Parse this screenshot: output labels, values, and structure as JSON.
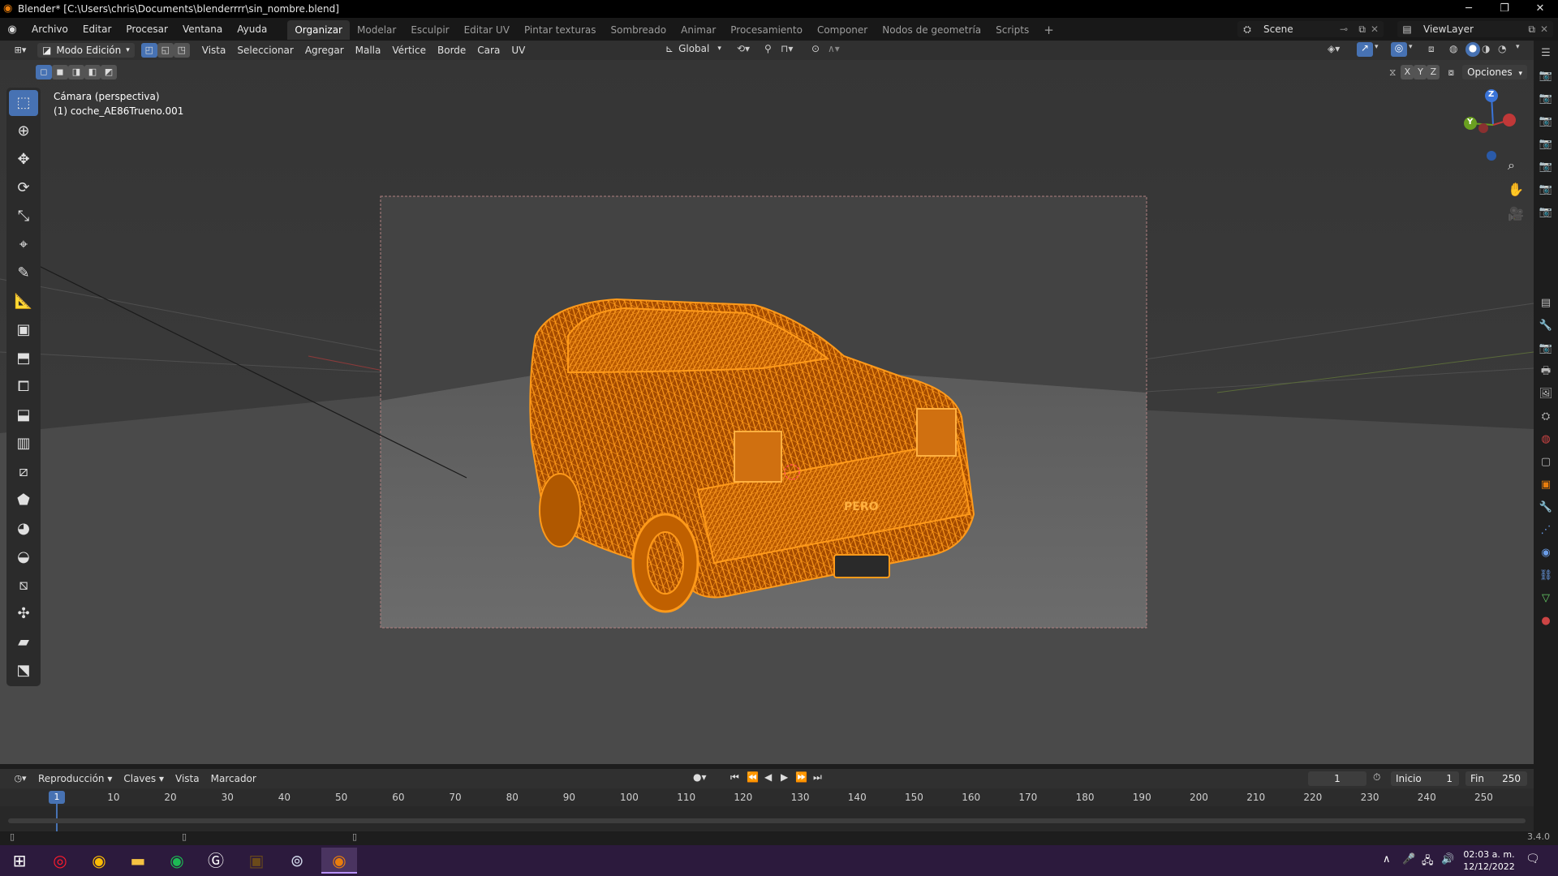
{
  "window": {
    "title": "Blender* [C:\\Users\\chris\\Documents\\blenderrrr\\sin_nombre.blend]",
    "minimize": "─",
    "maximize": "❐",
    "close": "✕"
  },
  "menu": {
    "items": [
      "Archivo",
      "Editar",
      "Procesar",
      "Ventana",
      "Ayuda"
    ],
    "workspaces": [
      "Organizar",
      "Modelar",
      "Esculpir",
      "Editar UV",
      "Pintar texturas",
      "Sombreado",
      "Animar",
      "Procesamiento",
      "Componer",
      "Nodos de geometría",
      "Scripts"
    ],
    "active_workspace": "Organizar",
    "add_tab": "+",
    "scene": "Scene",
    "view_layer": "ViewLayer"
  },
  "header3d": {
    "mode": "Modo Edición",
    "menus": [
      "Vista",
      "Seleccionar",
      "Agregar",
      "Malla",
      "Vértice",
      "Borde",
      "Cara",
      "UV"
    ],
    "orientation": "Global",
    "axes": [
      "X",
      "Y",
      "Z"
    ],
    "options": "Opciones"
  },
  "viewport": {
    "camera_label": "Cámara (perspectiva)",
    "object_label": "(1) coche_AE86Trueno.001",
    "plate_text": "PERO",
    "gizmo": {
      "z": "Z",
      "y": "Y"
    }
  },
  "timeline": {
    "menus": [
      "Reproducción",
      "Claves",
      "Vista",
      "Marcador"
    ],
    "current_frame": "1",
    "start_label": "Inicio",
    "start": "1",
    "end_label": "Fin",
    "end": "250",
    "ticks": [
      "10",
      "20",
      "30",
      "40",
      "50",
      "60",
      "70",
      "80",
      "90",
      "100",
      "110",
      "120",
      "130",
      "140",
      "150",
      "160",
      "170",
      "180",
      "190",
      "200",
      "210",
      "220",
      "230",
      "240",
      "250"
    ],
    "frame_marker": "1"
  },
  "status": {
    "version": "3.4.0"
  },
  "taskbar": {
    "time": "02:03 a. m.",
    "date": "12/12/2022"
  },
  "colors": {
    "accent": "#4772b3",
    "wire": "#ff8c00",
    "camera_frame": "#8a8a8a",
    "taskbar": "#2c1a3d"
  }
}
